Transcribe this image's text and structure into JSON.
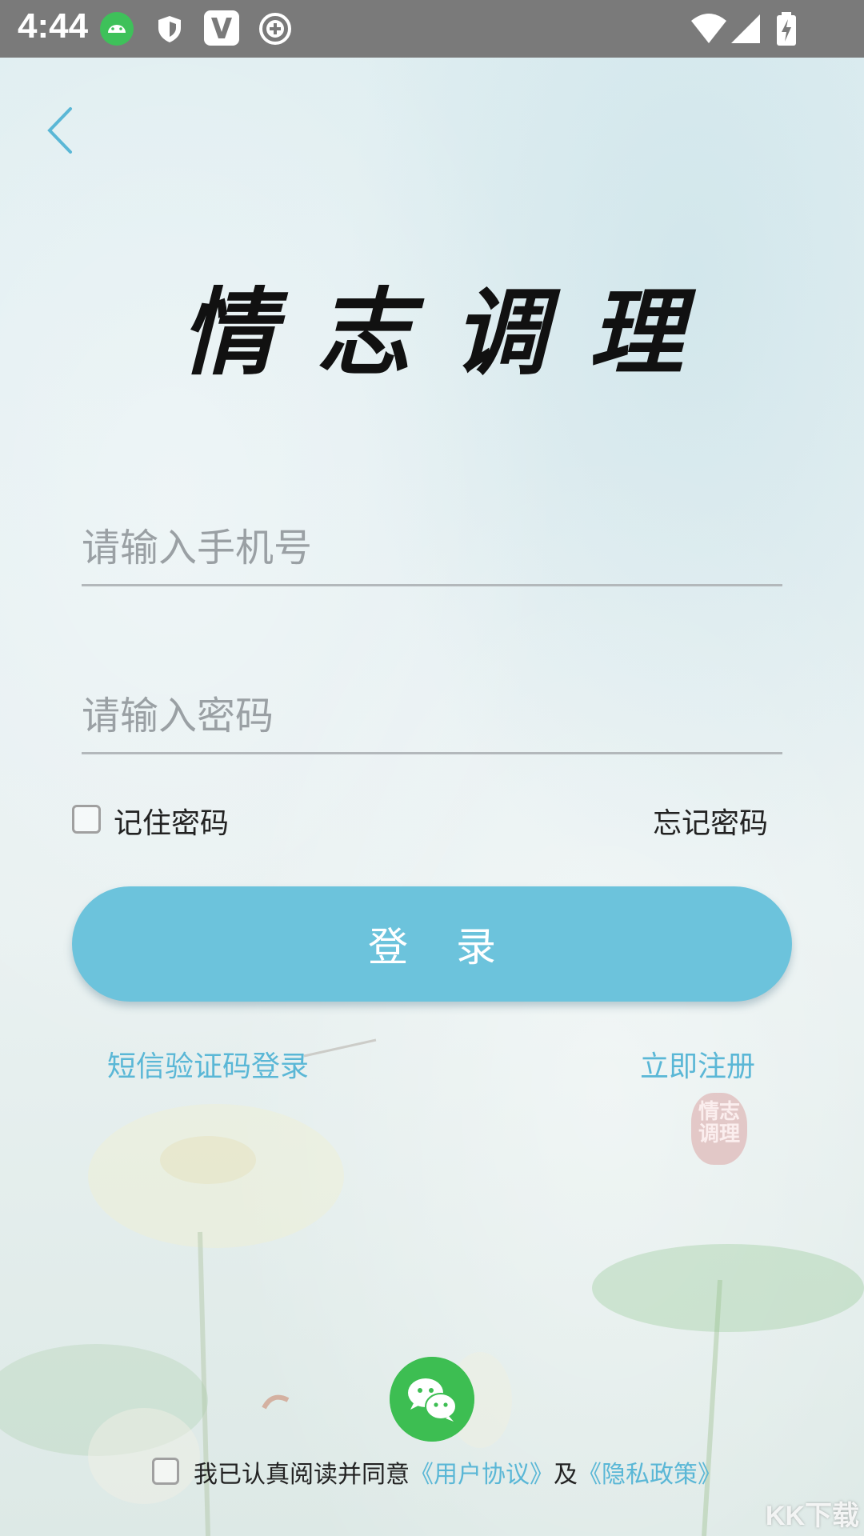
{
  "status_bar": {
    "time": "4:44",
    "icons": [
      "android-icon",
      "shield-icon",
      "v-app-icon",
      "add-circle-icon",
      "wifi-icon",
      "signal-icon",
      "battery-charging-icon"
    ]
  },
  "header": {
    "back_icon": "chevron-left-icon",
    "title": "情志调理"
  },
  "form": {
    "phone_placeholder": "请输入手机号",
    "phone_value": "",
    "password_placeholder": "请输入密码",
    "password_value": "",
    "remember_label": "记住密码",
    "remember_checked": false,
    "forgot_label": "忘记密码",
    "login_label": "登录"
  },
  "links": {
    "sms_login": "短信验证码登录",
    "register": "立即注册"
  },
  "seal_text": "情志调理",
  "wechat_icon": "wechat-icon",
  "agreement": {
    "checked": false,
    "prefix": "我已认真阅读并同意",
    "user_agreement": "《用户协议》",
    "and": "及",
    "privacy_policy": "《隐私政策》"
  },
  "watermark": "KK下载",
  "colors": {
    "accent": "#6cc3dc",
    "link": "#5ab7d6",
    "wechat": "#3dbe52",
    "status_bar": "#7a7a7a"
  }
}
